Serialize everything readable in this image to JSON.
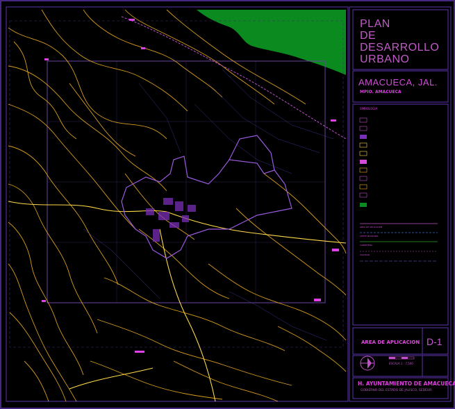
{
  "title_block": {
    "title_lines": [
      "PLAN",
      "DE",
      "DESARROLLO",
      "URBANO"
    ],
    "town": "AMACUECA, JAL.",
    "municipality": "MPIO. AMACUECA",
    "legend_heading": "SIMBOLOGIA",
    "area_label": "AREA DE APLICACION",
    "sheet_code": "D-1",
    "scale_label": "ESCALA 1 : 7,500",
    "authority": "H. AYUNTAMIENTO DE AMACUECA",
    "government": "GOBIERNO DEL ESTADO DE JALISCO, SEDEUR"
  },
  "colors": {
    "background": "#000000",
    "contour": "#f0b020",
    "frame": "#7a3ec8",
    "accent": "#d54bd8",
    "water_body": "#0b8a1f",
    "grid": "#5a3a8a"
  },
  "legend": {
    "line_labels": [
      "AREA DE APLICACION",
      "LIMITE MUNICIPAL",
      "CARRETERA",
      "VIALIDAD"
    ]
  }
}
